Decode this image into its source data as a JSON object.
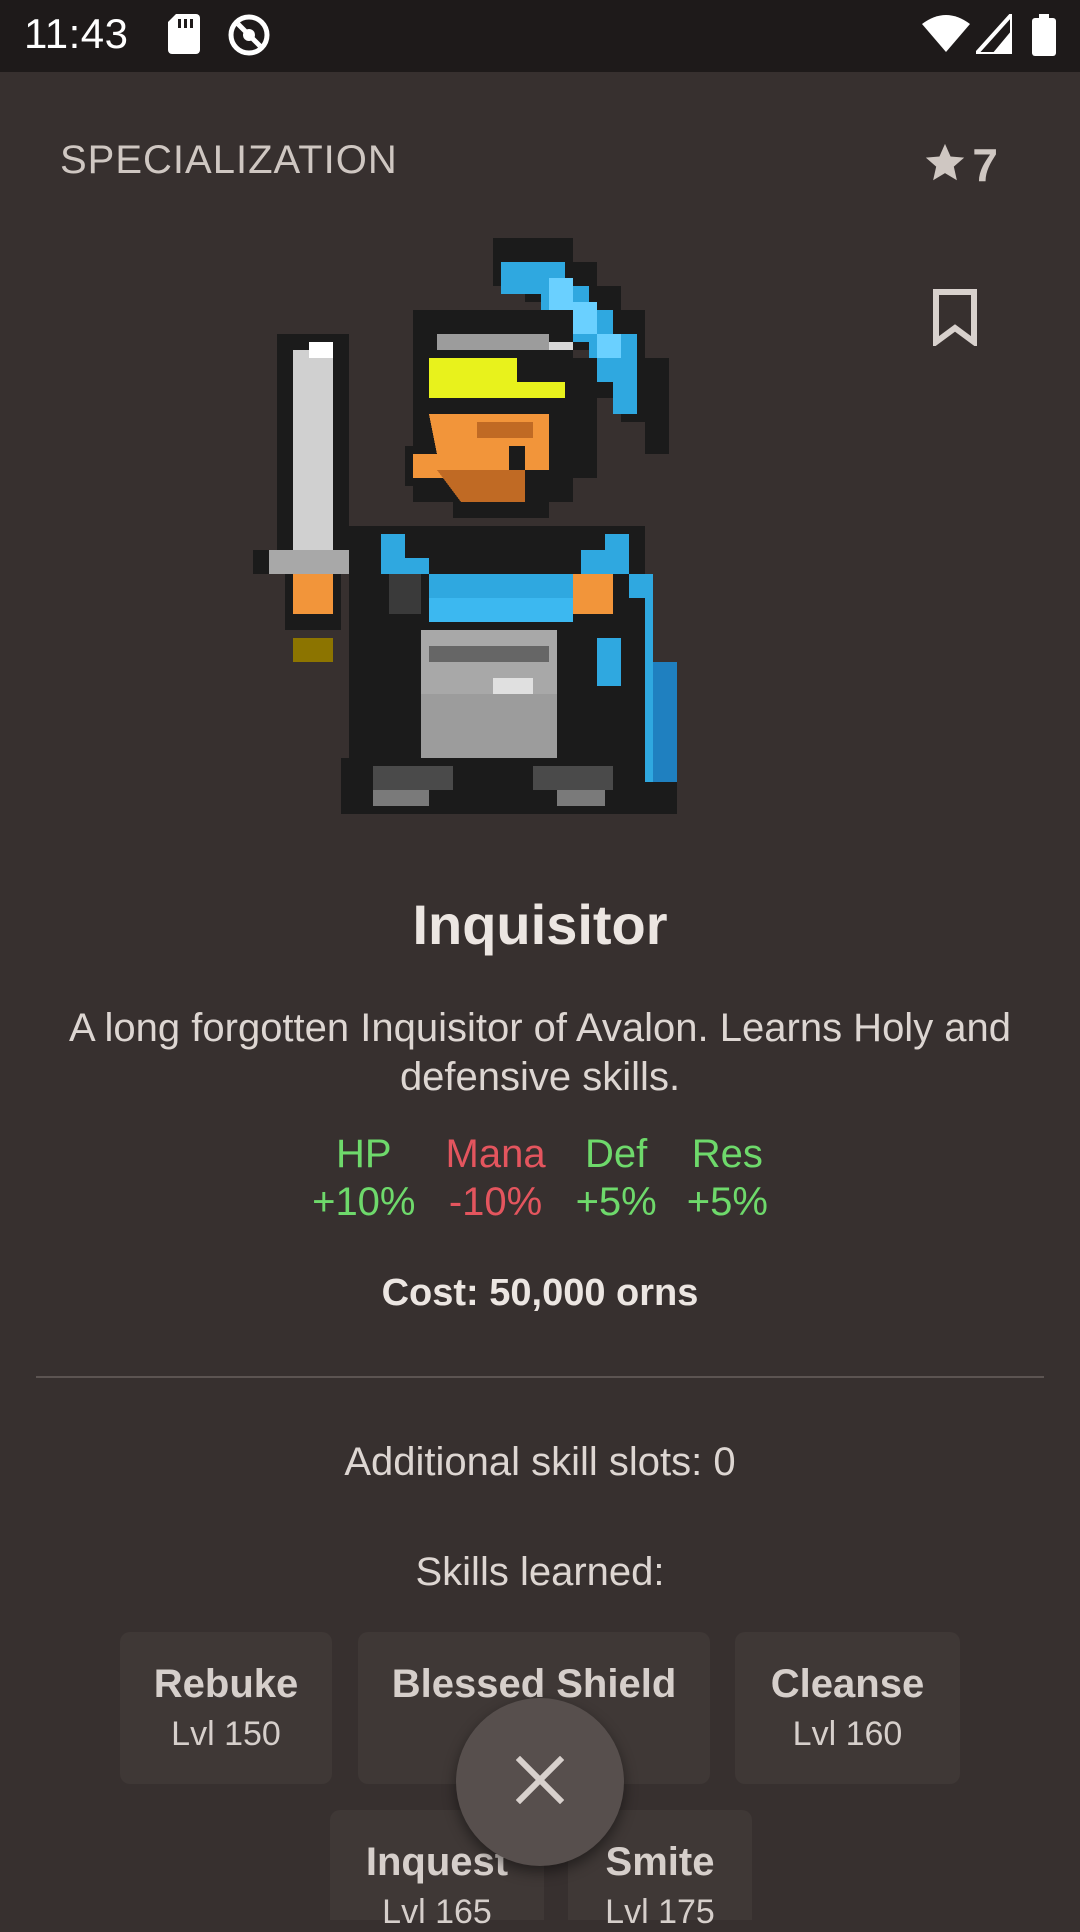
{
  "status_bar": {
    "time": "11:43"
  },
  "header": {
    "title": "SPECIALIZATION",
    "rank": "7"
  },
  "class": {
    "name": "Inquisitor",
    "description": "A long forgotten Inquisitor of Avalon.  Learns Holy and defensive skills.",
    "stats": [
      {
        "label": "HP",
        "value": "+10%",
        "color": "#6ed96b"
      },
      {
        "label": "Mana",
        "value": "-10%",
        "color": "#e4555e"
      },
      {
        "label": "Def",
        "value": "+5%",
        "color": "#6ed96b"
      },
      {
        "label": "Res",
        "value": "+5%",
        "color": "#6ed96b"
      }
    ],
    "cost": "Cost: 50,000 orns",
    "additional_slots": "Additional skill slots: 0",
    "skills_label": "Skills learned:",
    "skills": [
      {
        "name": "Rebuke",
        "level": "Lvl 150"
      },
      {
        "name": "Blessed Shield",
        "level": ""
      },
      {
        "name": "Cleanse",
        "level": "Lvl 160"
      },
      {
        "name": "Inquest",
        "level": "Lvl 165"
      },
      {
        "name": "Smite",
        "level": "Lvl 175"
      }
    ]
  },
  "icons": {
    "rank": "star-icon",
    "bookmark": "bookmark-icon",
    "close": "close-icon",
    "sd_card": "sd-card-icon",
    "sync": "sync-icon",
    "wifi": "wifi-icon",
    "signal": "signal-icon",
    "battery": "battery-icon"
  }
}
